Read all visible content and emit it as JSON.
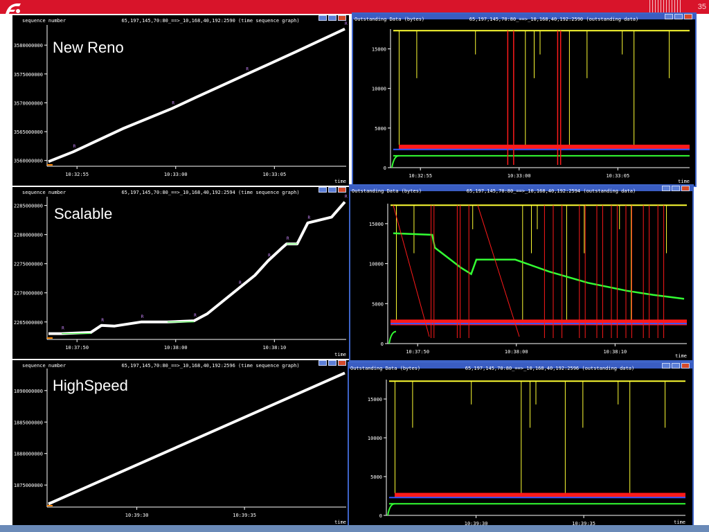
{
  "page": {
    "number": "35"
  },
  "colors": {
    "background": "#000000",
    "white": "#ffffff",
    "yellow": "#ffff33",
    "red": "#ff1a1a",
    "blue": "#3355ff",
    "green": "#33ff33",
    "purple": "#cc88ff",
    "frame": "#3e64c8",
    "titlebar": "#3a5dc2"
  },
  "chart_data": [
    {
      "type": "scatter",
      "label": "New Reno",
      "title": "65,197,145,70:80_==>_10,168,40,192:2590 (time sequence graph)",
      "ylabel": "sequence number",
      "xlabel": "time",
      "x_ticks": [
        "10:32:55",
        "10:33:00",
        "10:33:05"
      ],
      "y_ticks": [
        "3560000000",
        "3565000000",
        "3570000000",
        "3575000000",
        "3580000000"
      ],
      "ylim": [
        3559000000,
        3583500000
      ],
      "series": [
        {
          "values": [
            [
              0,
              3559800000
            ],
            [
              0.1,
              3561500000
            ],
            [
              0.3,
              3565500000
            ],
            [
              0.5,
              3569000000
            ],
            [
              0.6,
              3571000000
            ],
            [
              0.8,
              3574900000
            ],
            [
              1.0,
              3578800000
            ],
            [
              1.2,
              3582800000
            ]
          ]
        }
      ]
    },
    {
      "type": "line",
      "label": "",
      "title": "65,197,145,70:80_==>_10,168,40,192:2590 (outstanding data)",
      "ylabel": "Outstanding Data (bytes)",
      "xlabel": "time",
      "x_ticks": [
        "10:32:55",
        "10:33:00",
        "10:33:05"
      ],
      "y_ticks": [
        "0",
        "5000",
        "10000",
        "15000"
      ],
      "ylim": [
        0,
        17500
      ],
      "series": [
        {
          "color": "yellow",
          "values": [
            17300
          ]
        },
        {
          "color": "red",
          "values": [
            2300,
            2900
          ]
        },
        {
          "color": "blue",
          "values": [
            2300
          ]
        },
        {
          "color": "green",
          "values": [
            1500
          ]
        }
      ]
    },
    {
      "type": "scatter",
      "label": "Scalable",
      "title": "65,197,145,70:80_==>_10,168,40,192:2594 (time sequence graph)",
      "ylabel": "sequence number",
      "xlabel": "time",
      "x_ticks": [
        "10:37:50",
        "10:38:00",
        "10:38:10"
      ],
      "y_ticks": [
        "2265000000",
        "2270000000",
        "2275000000",
        "2280000000",
        "2285000000"
      ],
      "ylim": [
        2262000000,
        2286500000
      ],
      "series": [
        {
          "values": [
            [
              0,
              2263000000
            ],
            [
              0.05,
              2263000000
            ],
            [
              0.16,
              2263200000
            ],
            [
              0.2,
              2264400000
            ],
            [
              0.25,
              2264300000
            ],
            [
              0.35,
              2265000000
            ],
            [
              0.45,
              2265000000
            ],
            [
              0.55,
              2265200000
            ],
            [
              0.6,
              2266400000
            ],
            [
              0.72,
              2270800000
            ],
            [
              0.78,
              2273000000
            ],
            [
              0.83,
              2275500000
            ],
            [
              0.88,
              2277600000
            ],
            [
              0.9,
              2278400000
            ],
            [
              0.94,
              2278400000
            ],
            [
              0.98,
              2282000000
            ],
            [
              1.07,
              2283000000
            ],
            [
              1.12,
              2285600000
            ]
          ]
        }
      ]
    },
    {
      "type": "line",
      "label": "",
      "title": "65,197,145,70:80_==>_10,168,40,192:2594 (outstanding data)",
      "ylabel": "Outstanding Data (bytes)",
      "xlabel": "time",
      "x_ticks": [
        "10:37:50",
        "10:38:00",
        "10:38:10"
      ],
      "y_ticks": [
        "0",
        "5000",
        "10000",
        "15000"
      ],
      "ylim": [
        0,
        17500
      ],
      "series": [
        {
          "color": "yellow",
          "values": [
            17300
          ]
        },
        {
          "color": "green",
          "values": [
            [
              0.0,
              13800
            ],
            [
              0.15,
              13600
            ],
            [
              0.16,
              12000
            ],
            [
              0.22,
              10500
            ],
            [
              0.26,
              9500
            ],
            [
              0.3,
              8700
            ],
            [
              0.32,
              10500
            ],
            [
              0.47,
              10500
            ],
            [
              0.6,
              9000
            ],
            [
              0.75,
              7600
            ],
            [
              0.9,
              6600
            ],
            [
              1.0,
              6100
            ],
            [
              1.12,
              5600
            ]
          ]
        },
        {
          "color": "blue",
          "values": [
            2500
          ]
        },
        {
          "color": "red",
          "values": [
            2300,
            3000
          ]
        }
      ]
    },
    {
      "type": "scatter",
      "label": "HighSpeed",
      "title": "65,197,145,70:80_==>_10,168,40,192:2596 (time sequence graph)",
      "ylabel": "sequence number",
      "xlabel": "time",
      "x_ticks": [
        "10:39:30",
        "10:39:35"
      ],
      "y_ticks": [
        "1875000000",
        "1880000000",
        "1885000000",
        "1890000000"
      ],
      "ylim": [
        1871500000,
        1893500000
      ],
      "series": [
        {
          "values": [
            [
              0,
              1872000000
            ],
            [
              1.0,
              1892800000
            ]
          ]
        }
      ]
    },
    {
      "type": "line",
      "label": "",
      "title": "65,197,145,70:80_==>_10,168,40,192:2596 (outstanding data)",
      "ylabel": "Outstanding Data (bytes)",
      "xlabel": "time",
      "x_ticks": [
        "10:39:30",
        "10:39:35"
      ],
      "y_ticks": [
        "0",
        "5000",
        "10000",
        "15000"
      ],
      "ylim": [
        0,
        17500
      ],
      "series": [
        {
          "color": "yellow",
          "values": [
            17300
          ]
        },
        {
          "color": "red",
          "values": [
            2300,
            2900
          ]
        },
        {
          "color": "blue",
          "values": [
            2300
          ]
        },
        {
          "color": "green",
          "values": [
            1500
          ]
        }
      ]
    }
  ]
}
